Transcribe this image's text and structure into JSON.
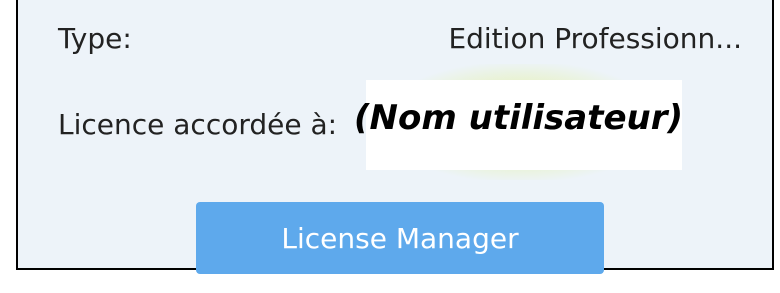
{
  "license_info": {
    "type_label": "Type:",
    "type_value": "Edition Professionn...",
    "licensed_to_label": "Licence accordée à:",
    "licensed_to_value": "(Nom utilisateur)",
    "license_manager_button": "License Manager"
  },
  "colors": {
    "panel_background": "#edf3f9",
    "button_background": "#5ea9ec",
    "button_text": "#ffffff",
    "text": "#222222"
  }
}
